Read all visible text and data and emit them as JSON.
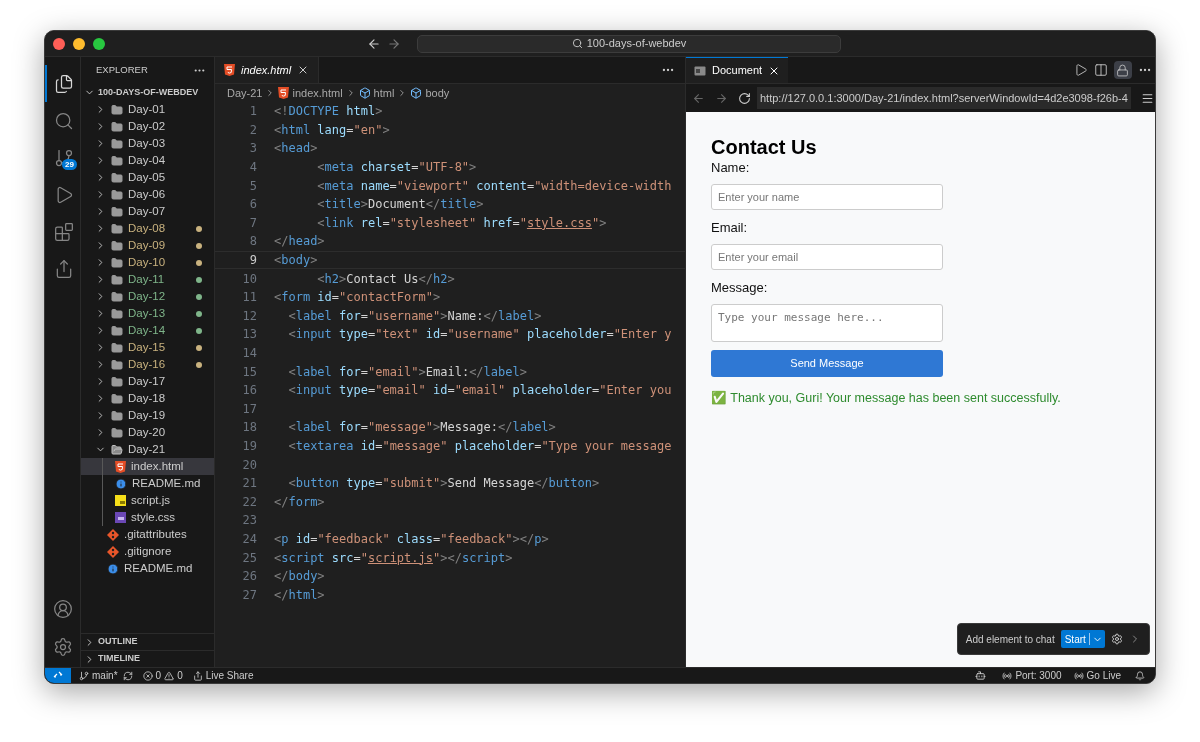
{
  "titlebar": {
    "search": "100-days-of-webdev"
  },
  "activity_bar": {
    "items": [
      {
        "kind": "files",
        "selected": true
      },
      {
        "kind": "search",
        "selected": false
      },
      {
        "kind": "scm",
        "selected": false,
        "badge": "29"
      },
      {
        "kind": "run",
        "selected": false
      },
      {
        "kind": "extensions",
        "selected": false
      },
      {
        "kind": "share",
        "selected": false
      }
    ]
  },
  "explorer": {
    "title": "EXPLORER",
    "root": "100-DAYS-OF-WEBDEV",
    "items": [
      {
        "label": "Day-01",
        "kind": "folder",
        "expanded": false,
        "selected": false
      },
      {
        "label": "Day-02",
        "kind": "folder",
        "expanded": false,
        "selected": false
      },
      {
        "label": "Day-03",
        "kind": "folder",
        "expanded": false,
        "selected": false
      },
      {
        "label": "Day-04",
        "kind": "folder",
        "expanded": false,
        "selected": false
      },
      {
        "label": "Day-05",
        "kind": "folder",
        "expanded": false,
        "selected": false
      },
      {
        "label": "Day-06",
        "kind": "folder",
        "expanded": false,
        "selected": false
      },
      {
        "label": "Day-07",
        "kind": "folder",
        "expanded": false,
        "selected": false
      },
      {
        "label": "Day-08",
        "kind": "folder",
        "expanded": false,
        "selected": false,
        "color": "#c9b27f"
      },
      {
        "label": "Day-09",
        "kind": "folder",
        "expanded": false,
        "selected": false,
        "color": "#c9b27f"
      },
      {
        "label": "Day-10",
        "kind": "folder",
        "expanded": false,
        "selected": false,
        "color": "#c9b27f"
      },
      {
        "label": "Day-11",
        "kind": "folder",
        "expanded": false,
        "selected": false,
        "color": "#7fb58a"
      },
      {
        "label": "Day-12",
        "kind": "folder",
        "expanded": false,
        "selected": false,
        "color": "#7fb58a"
      },
      {
        "label": "Day-13",
        "kind": "folder",
        "expanded": false,
        "selected": false,
        "color": "#7fb58a"
      },
      {
        "label": "Day-14",
        "kind": "folder",
        "expanded": false,
        "selected": false,
        "color": "#7fb58a"
      },
      {
        "label": "Day-15",
        "kind": "folder",
        "expanded": false,
        "selected": false,
        "color": "#c9b27f"
      },
      {
        "label": "Day-16",
        "kind": "folder",
        "expanded": false,
        "selected": false,
        "color": "#c9b27f"
      },
      {
        "label": "Day-17",
        "kind": "folder",
        "expanded": false,
        "selected": false
      },
      {
        "label": "Day-18",
        "kind": "folder",
        "expanded": false,
        "selected": false
      },
      {
        "label": "Day-19",
        "kind": "folder",
        "expanded": false,
        "selected": false
      },
      {
        "label": "Day-20",
        "kind": "folder",
        "expanded": false,
        "selected": false
      },
      {
        "label": "Day-21",
        "kind": "folder",
        "expanded": true,
        "selected": false,
        "children": [
          {
            "label": "index.html",
            "kind": "html",
            "selected": true
          },
          {
            "label": "README.md",
            "kind": "md",
            "selected": false
          },
          {
            "label": "script.js",
            "kind": "js",
            "selected": false
          },
          {
            "label": "style.css",
            "kind": "css",
            "selected": false
          }
        ]
      },
      {
        "label": ".gitattributes",
        "kind": "git",
        "selected": false
      },
      {
        "label": ".gitignore",
        "kind": "git",
        "selected": false
      },
      {
        "label": "README.md",
        "kind": "md",
        "selected": false
      }
    ],
    "sections": [
      {
        "label": "OUTLINE",
        "expanded": false
      },
      {
        "label": "TIMELINE",
        "expanded": false
      }
    ]
  },
  "editor": {
    "tabs": [
      {
        "label": "index.html",
        "selected": true,
        "preview": true
      }
    ],
    "breadcrumb": [
      {
        "label": "Day-21",
        "kind": "folder"
      },
      {
        "label": "index.html",
        "kind": "html"
      },
      {
        "label": "html",
        "kind": "element"
      },
      {
        "label": "body",
        "kind": "element"
      }
    ],
    "lines": [
      {
        "number": "1",
        "current": false,
        "code": [
          {
            "kind": "p",
            "text": "<!"
          },
          {
            "kind": "tag",
            "text": "DOCTYPE"
          },
          {
            "kind": "attr",
            "text": " html"
          },
          {
            "kind": "p",
            "text": ">"
          }
        ]
      },
      {
        "number": "2",
        "current": false,
        "code": [
          {
            "kind": "p",
            "text": "<"
          },
          {
            "kind": "tag",
            "text": "html"
          },
          {
            "kind": "attr",
            "text": " lang"
          },
          {
            "kind": "txt",
            "text": "="
          },
          {
            "kind": "str",
            "text": "\"en\""
          },
          {
            "kind": "p",
            "text": ">"
          }
        ]
      },
      {
        "number": "3",
        "current": false,
        "code": [
          {
            "kind": "p",
            "text": "<"
          },
          {
            "kind": "tag",
            "text": "head"
          },
          {
            "kind": "p",
            "text": ">"
          }
        ]
      },
      {
        "number": "4",
        "current": false,
        "code": [
          {
            "kind": "p",
            "text": "      <"
          },
          {
            "kind": "tag",
            "text": "meta"
          },
          {
            "kind": "attr",
            "text": " charset"
          },
          {
            "kind": "txt",
            "text": "="
          },
          {
            "kind": "str",
            "text": "\"UTF-8\""
          },
          {
            "kind": "p",
            "text": ">"
          }
        ]
      },
      {
        "number": "5",
        "current": false,
        "code": [
          {
            "kind": "p",
            "text": "      <"
          },
          {
            "kind": "tag",
            "text": "meta"
          },
          {
            "kind": "attr",
            "text": " name"
          },
          {
            "kind": "txt",
            "text": "="
          },
          {
            "kind": "str",
            "text": "\"viewport\""
          },
          {
            "kind": "attr",
            "text": " content"
          },
          {
            "kind": "txt",
            "text": "="
          },
          {
            "kind": "str",
            "text": "\"width=device-width"
          }
        ]
      },
      {
        "number": "6",
        "current": false,
        "code": [
          {
            "kind": "p",
            "text": "      <"
          },
          {
            "kind": "tag",
            "text": "title"
          },
          {
            "kind": "p",
            "text": ">"
          },
          {
            "kind": "txt",
            "text": "Document"
          },
          {
            "kind": "p",
            "text": "</"
          },
          {
            "kind": "tag",
            "text": "title"
          },
          {
            "kind": "p",
            "text": ">"
          }
        ]
      },
      {
        "number": "7",
        "current": false,
        "code": [
          {
            "kind": "p",
            "text": "      <"
          },
          {
            "kind": "tag",
            "text": "link"
          },
          {
            "kind": "attr",
            "text": " rel"
          },
          {
            "kind": "txt",
            "text": "="
          },
          {
            "kind": "str",
            "text": "\"stylesheet\""
          },
          {
            "kind": "attr",
            "text": " href"
          },
          {
            "kind": "txt",
            "text": "="
          },
          {
            "kind": "str",
            "text": "\""
          },
          {
            "kind": "link",
            "text": "style.css"
          },
          {
            "kind": "str",
            "text": "\""
          },
          {
            "kind": "p",
            "text": ">"
          }
        ]
      },
      {
        "number": "8",
        "current": false,
        "code": [
          {
            "kind": "p",
            "text": "</"
          },
          {
            "kind": "tag",
            "text": "head"
          },
          {
            "kind": "p",
            "text": ">"
          }
        ]
      },
      {
        "number": "9",
        "current": true,
        "code": [
          {
            "kind": "p",
            "text": "<"
          },
          {
            "kind": "tag",
            "text": "body"
          },
          {
            "kind": "p",
            "text": ">"
          }
        ]
      },
      {
        "number": "10",
        "current": false,
        "code": [
          {
            "kind": "p",
            "text": "      <"
          },
          {
            "kind": "tag",
            "text": "h2"
          },
          {
            "kind": "p",
            "text": ">"
          },
          {
            "kind": "txt",
            "text": "Contact Us"
          },
          {
            "kind": "p",
            "text": "</"
          },
          {
            "kind": "tag",
            "text": "h2"
          },
          {
            "kind": "p",
            "text": ">"
          }
        ]
      },
      {
        "number": "11",
        "current": false,
        "code": [
          {
            "kind": "p",
            "text": "<"
          },
          {
            "kind": "tag",
            "text": "form"
          },
          {
            "kind": "attr",
            "text": " id"
          },
          {
            "kind": "txt",
            "text": "="
          },
          {
            "kind": "str",
            "text": "\"contactForm\""
          },
          {
            "kind": "p",
            "text": ">"
          }
        ]
      },
      {
        "number": "12",
        "current": false,
        "code": [
          {
            "kind": "p",
            "text": "  <"
          },
          {
            "kind": "tag",
            "text": "label"
          },
          {
            "kind": "attr",
            "text": " for"
          },
          {
            "kind": "txt",
            "text": "="
          },
          {
            "kind": "str",
            "text": "\"username\""
          },
          {
            "kind": "p",
            "text": ">"
          },
          {
            "kind": "txt",
            "text": "Name:"
          },
          {
            "kind": "p",
            "text": "</"
          },
          {
            "kind": "tag",
            "text": "label"
          },
          {
            "kind": "p",
            "text": ">"
          }
        ]
      },
      {
        "number": "13",
        "current": false,
        "code": [
          {
            "kind": "p",
            "text": "  <"
          },
          {
            "kind": "tag",
            "text": "input"
          },
          {
            "kind": "attr",
            "text": " type"
          },
          {
            "kind": "txt",
            "text": "="
          },
          {
            "kind": "str",
            "text": "\"text\""
          },
          {
            "kind": "attr",
            "text": " id"
          },
          {
            "kind": "txt",
            "text": "="
          },
          {
            "kind": "str",
            "text": "\"username\""
          },
          {
            "kind": "attr",
            "text": " placeholder"
          },
          {
            "kind": "txt",
            "text": "="
          },
          {
            "kind": "str",
            "text": "\"Enter y"
          }
        ]
      },
      {
        "number": "14",
        "current": false
      },
      {
        "number": "15",
        "current": false,
        "code": [
          {
            "kind": "p",
            "text": "  <"
          },
          {
            "kind": "tag",
            "text": "label"
          },
          {
            "kind": "attr",
            "text": " for"
          },
          {
            "kind": "txt",
            "text": "="
          },
          {
            "kind": "str",
            "text": "\"email\""
          },
          {
            "kind": "p",
            "text": ">"
          },
          {
            "kind": "txt",
            "text": "Email:"
          },
          {
            "kind": "p",
            "text": "</"
          },
          {
            "kind": "tag",
            "text": "label"
          },
          {
            "kind": "p",
            "text": ">"
          }
        ]
      },
      {
        "number": "16",
        "current": false,
        "code": [
          {
            "kind": "p",
            "text": "  <"
          },
          {
            "kind": "tag",
            "text": "input"
          },
          {
            "kind": "attr",
            "text": " type"
          },
          {
            "kind": "txt",
            "text": "="
          },
          {
            "kind": "str",
            "text": "\"email\""
          },
          {
            "kind": "attr",
            "text": " id"
          },
          {
            "kind": "txt",
            "text": "="
          },
          {
            "kind": "str",
            "text": "\"email\""
          },
          {
            "kind": "attr",
            "text": " placeholder"
          },
          {
            "kind": "txt",
            "text": "="
          },
          {
            "kind": "str",
            "text": "\"Enter you"
          }
        ]
      },
      {
        "number": "17",
        "current": false
      },
      {
        "number": "18",
        "current": false,
        "code": [
          {
            "kind": "p",
            "text": "  <"
          },
          {
            "kind": "tag",
            "text": "label"
          },
          {
            "kind": "attr",
            "text": " for"
          },
          {
            "kind": "txt",
            "text": "="
          },
          {
            "kind": "str",
            "text": "\"message\""
          },
          {
            "kind": "p",
            "text": ">"
          },
          {
            "kind": "txt",
            "text": "Message:"
          },
          {
            "kind": "p",
            "text": "</"
          },
          {
            "kind": "tag",
            "text": "label"
          },
          {
            "kind": "p",
            "text": ">"
          }
        ]
      },
      {
        "number": "19",
        "current": false,
        "code": [
          {
            "kind": "p",
            "text": "  <"
          },
          {
            "kind": "tag",
            "text": "textarea"
          },
          {
            "kind": "attr",
            "text": " id"
          },
          {
            "kind": "txt",
            "text": "="
          },
          {
            "kind": "str",
            "text": "\"message\""
          },
          {
            "kind": "attr",
            "text": " placeholder"
          },
          {
            "kind": "txt",
            "text": "="
          },
          {
            "kind": "str",
            "text": "\"Type your message"
          }
        ]
      },
      {
        "number": "20",
        "current": false
      },
      {
        "number": "21",
        "current": false,
        "code": [
          {
            "kind": "p",
            "text": "  <"
          },
          {
            "kind": "tag",
            "text": "button"
          },
          {
            "kind": "attr",
            "text": " type"
          },
          {
            "kind": "txt",
            "text": "="
          },
          {
            "kind": "str",
            "text": "\"submit\""
          },
          {
            "kind": "p",
            "text": ">"
          },
          {
            "kind": "txt",
            "text": "Send Message"
          },
          {
            "kind": "p",
            "text": "</"
          },
          {
            "kind": "tag",
            "text": "button"
          },
          {
            "kind": "p",
            "text": ">"
          }
        ]
      },
      {
        "number": "22",
        "current": false,
        "code": [
          {
            "kind": "p",
            "text": "</"
          },
          {
            "kind": "tag",
            "text": "form"
          },
          {
            "kind": "p",
            "text": ">"
          }
        ]
      },
      {
        "number": "23",
        "current": false
      },
      {
        "number": "24",
        "current": false,
        "code": [
          {
            "kind": "p",
            "text": "<"
          },
          {
            "kind": "tag",
            "text": "p"
          },
          {
            "kind": "attr",
            "text": " id"
          },
          {
            "kind": "txt",
            "text": "="
          },
          {
            "kind": "str",
            "text": "\"feedback\""
          },
          {
            "kind": "attr",
            "text": " class"
          },
          {
            "kind": "txt",
            "text": "="
          },
          {
            "kind": "str",
            "text": "\"feedback\""
          },
          {
            "kind": "p",
            "text": "></"
          },
          {
            "kind": "tag",
            "text": "p"
          },
          {
            "kind": "p",
            "text": ">"
          }
        ]
      },
      {
        "number": "25",
        "current": false,
        "code": [
          {
            "kind": "p",
            "text": "<"
          },
          {
            "kind": "tag",
            "text": "script"
          },
          {
            "kind": "attr",
            "text": " src"
          },
          {
            "kind": "txt",
            "text": "="
          },
          {
            "kind": "str",
            "text": "\""
          },
          {
            "kind": "link",
            "text": "script.js"
          },
          {
            "kind": "str",
            "text": "\""
          },
          {
            "kind": "p",
            "text": "></"
          },
          {
            "kind": "tag",
            "text": "script"
          },
          {
            "kind": "p",
            "text": ">"
          }
        ]
      },
      {
        "number": "26",
        "current": false,
        "code": [
          {
            "kind": "p",
            "text": "</"
          },
          {
            "kind": "tag",
            "text": "body"
          },
          {
            "kind": "p",
            "text": ">"
          }
        ]
      },
      {
        "number": "27",
        "current": false,
        "code": [
          {
            "kind": "p",
            "text": "</"
          },
          {
            "kind": "tag",
            "text": "html"
          },
          {
            "kind": "p",
            "text": ">"
          }
        ]
      }
    ]
  },
  "browser": {
    "tab": {
      "label": "Document",
      "selected": true
    },
    "lock_on": true,
    "url": "http://127.0.0.1:3000/Day-21/index.html?serverWindowId=4d2e3098-f26b-4",
    "page": {
      "heading": "Contact Us",
      "fields": [
        {
          "label": "Name:",
          "placeholder": "Enter your name",
          "kind": "input"
        },
        {
          "label": "Email:",
          "placeholder": "Enter your email",
          "kind": "input"
        },
        {
          "label": "Message:",
          "placeholder": "Type your message here...",
          "kind": "textarea"
        }
      ],
      "button": "Send Message",
      "feedback": "✅ Thank you, Guri! Your message has been sent successfully."
    },
    "chat_widget": {
      "label": "Add element to chat",
      "button": "Start"
    }
  },
  "status_bar": {
    "branch": "main*",
    "errors": "0",
    "warnings": "0",
    "live_share": "Live Share",
    "port": "Port: 3000",
    "go_live": "Go Live"
  }
}
